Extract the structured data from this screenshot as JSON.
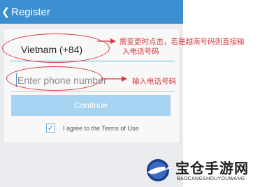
{
  "header": {
    "back_icon": "chevron-left-icon",
    "title": "Register",
    "color": "#3b8fd1"
  },
  "form": {
    "country": "Vietnam (+84)",
    "phone_placeholder": "Enter phone number",
    "continue_label": "Continue",
    "terms_checked": true,
    "terms_label": "I agree to the Terms of Use"
  },
  "annotations": {
    "country_note_line1": "需变更时点击，若是越南号码则直接输",
    "country_note_line2": "入电话号码",
    "phone_note": "输入电话号码",
    "color": "#d9363e"
  },
  "watermark": {
    "title": "宝仓手游网",
    "subtitle": "BAOCANGSHOUYOUWANG"
  }
}
